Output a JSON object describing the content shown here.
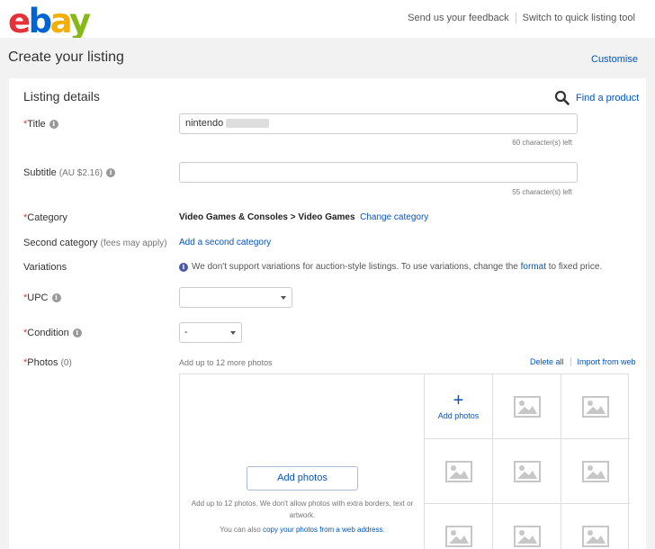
{
  "logo": {
    "l1": "e",
    "l2": "b",
    "l3": "a",
    "l4": "y"
  },
  "header": {
    "feedback": "Send us your feedback",
    "quick_tool": "Switch to quick listing tool"
  },
  "page": {
    "title": "Create your listing",
    "customise": "Customise"
  },
  "section": {
    "title": "Listing details",
    "find_product": "Find a product"
  },
  "fields": {
    "title": {
      "required": "*",
      "label": "Title",
      "value": "nintendo",
      "counter": "60 character(s) left"
    },
    "subtitle": {
      "label": "Subtitle",
      "fee": "(AU $2.16)",
      "value": "",
      "counter": "55 character(s) left"
    },
    "category": {
      "required": "*",
      "label": "Category",
      "value": "Video Games & Consoles > Video Games",
      "change": "Change category"
    },
    "second_category": {
      "label": "Second category",
      "fee": "(fees may apply)",
      "link": "Add a second category"
    },
    "variations": {
      "label": "Variations",
      "text_before": "We don't support variations for auction-style listings. To use variations, change the",
      "link": "format",
      "text_after": "to fixed price."
    },
    "upc": {
      "required": "*",
      "label": "UPC",
      "value": ""
    },
    "condition": {
      "required": "*",
      "label": "Condition",
      "value": "-"
    },
    "photos": {
      "required": "*",
      "label": "Photos",
      "count": "(0)"
    }
  },
  "photos": {
    "hint": "Add up to 12 more photos",
    "delete_all": "Delete all",
    "import_web": "Import from web",
    "add_button": "Add photos",
    "add_tile_label": "Add photos",
    "guideline": "Add up to 12 photos. We don't allow photos with extra borders, text or artwork.",
    "web_prefix": "You can also",
    "web_link": "copy your photos from a web address",
    "web_suffix": "."
  },
  "colors": {
    "link": "#0654ba",
    "required": "#e53238",
    "background": "#f2f2f2"
  }
}
